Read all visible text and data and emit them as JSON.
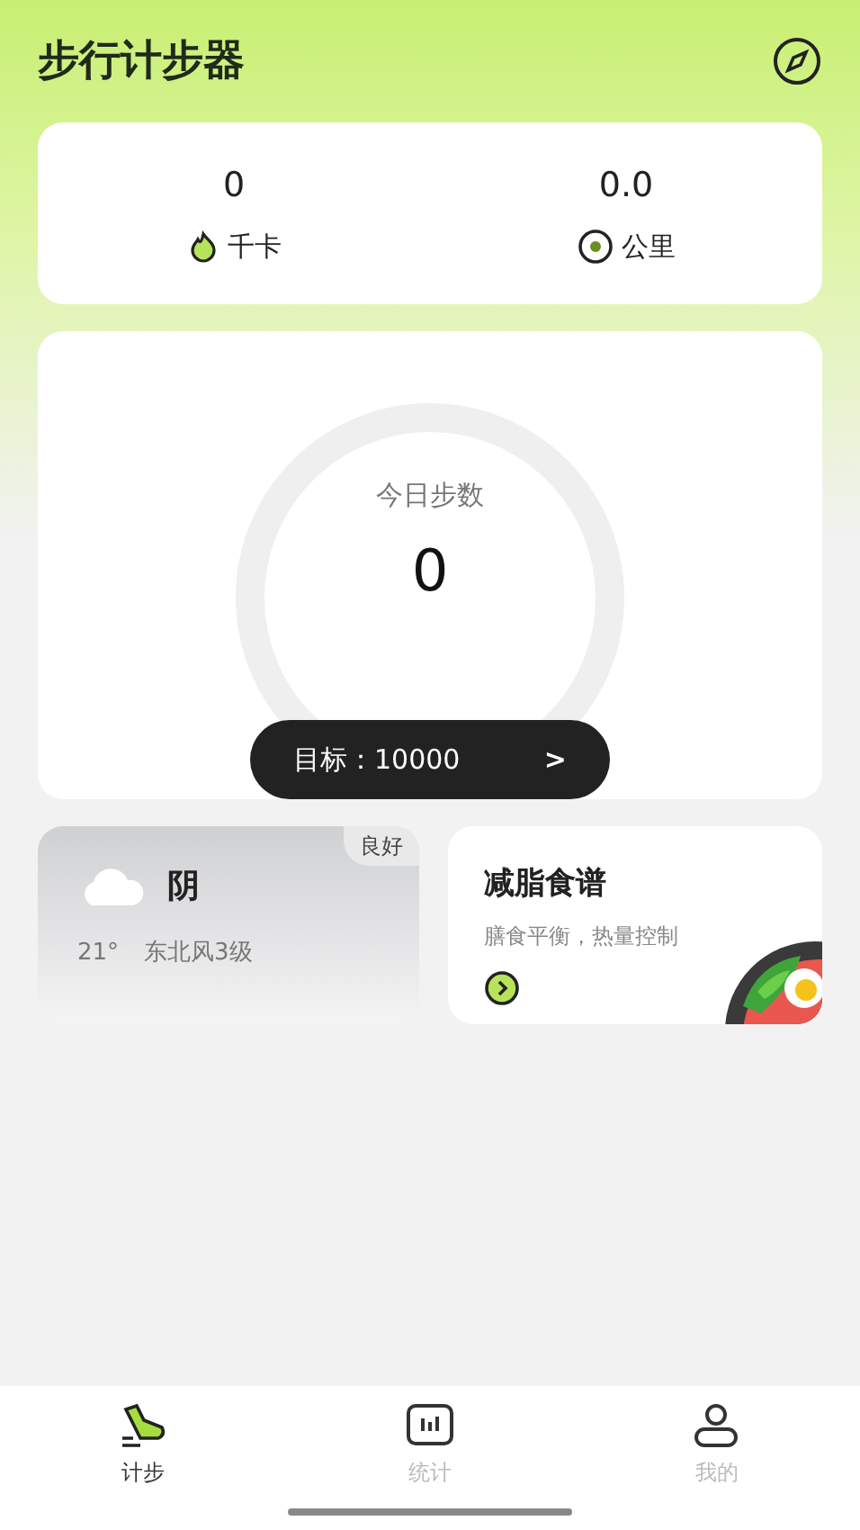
{
  "header": {
    "title": "步行计步器"
  },
  "stats": [
    {
      "kind": "calorie",
      "value": "0",
      "unit": "千卡"
    },
    {
      "kind": "distance",
      "value": "0.0",
      "unit": "公里"
    }
  ],
  "steps": {
    "label": "今日步数",
    "value": "0",
    "level": 0,
    "goal": "目标：10000",
    "chevron": ">"
  },
  "weather": {
    "badge": "良好",
    "condition": "阴",
    "temperature": "21°",
    "wind": "东北风3级"
  },
  "recipe": {
    "title": "减脂食谱",
    "subtitle": "膳食平衡，热量控制"
  },
  "tabs": [
    {
      "label": "计步",
      "kind": "steps",
      "selected": true
    },
    {
      "label": "统计",
      "kind": "stats",
      "selected": false
    },
    {
      "label": "我的",
      "kind": "profile",
      "selected": false
    }
  ]
}
